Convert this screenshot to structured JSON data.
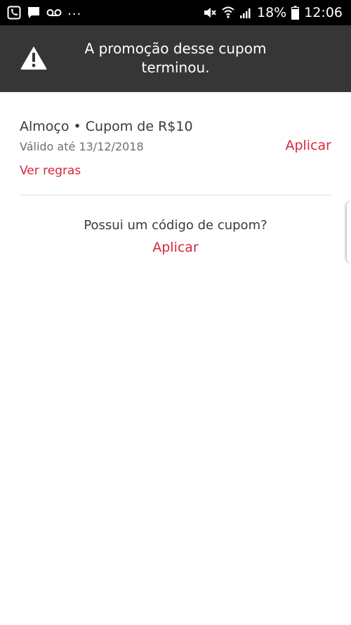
{
  "status_bar": {
    "left_icons": [
      "call-icon",
      "message-icon",
      "voicemail-icon"
    ],
    "more": "...",
    "right_icons": [
      "mute-icon",
      "wifi-icon",
      "signal-icon"
    ],
    "battery": "18%",
    "battery_icon": "battery-icon",
    "time": "12:06"
  },
  "banner": {
    "icon": "warning-icon",
    "message": "A promoção desse cupom terminou.",
    "background": "#363636"
  },
  "coupon": {
    "title": "Almoço • Cupom de R$10",
    "validity": "Válido até 13/12/2018",
    "apply_label": "Aplicar",
    "rules_label": "Ver regras"
  },
  "code_section": {
    "question": "Possui um código de cupom?",
    "apply_label": "Aplicar"
  },
  "colors": {
    "accent": "#d7263d",
    "text_primary": "#3a3a3a",
    "text_secondary": "#6e6e6e"
  }
}
